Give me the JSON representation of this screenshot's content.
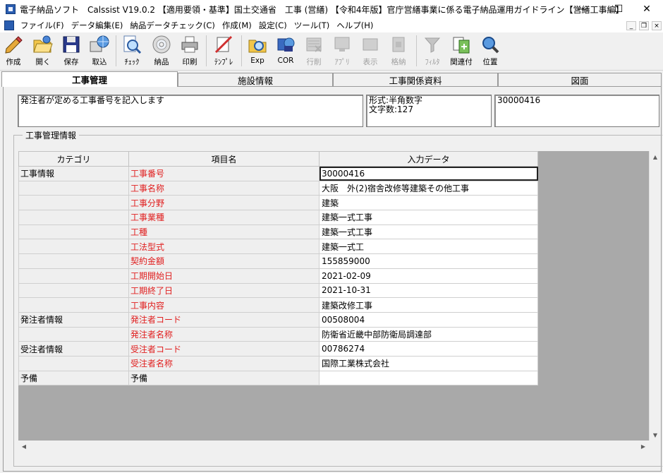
{
  "window": {
    "title": "電子納品ソフト　Calssist V19.0.2 【適用要領・基準】国土交通省　工事 (営繕) 【令和4年版】官庁営繕事業に係る電子納品運用ガイドライン【営繕工事編】",
    "minimize": "—",
    "maximize": "☐",
    "close": "✕"
  },
  "menu": {
    "items": [
      "ファイル(F)",
      "データ編集(E)",
      "納品データチェック(C)",
      "作成(M)",
      "設定(C)",
      "ツール(T)",
      "ヘルプ(H)"
    ],
    "mdi_min": "_",
    "mdi_restore": "❐",
    "mdi_close": "×"
  },
  "toolbar": {
    "create": "作成",
    "open": "開く",
    "save": "保存",
    "import": "取込",
    "check": "ﾁｪｯｸ",
    "deliver": "納品",
    "print": "印刷",
    "template": "ﾃﾝﾌﾟﾚ",
    "exp": "Exp",
    "cor": "COR",
    "row_delete": "行削",
    "app": "ｱﾌﾟﾘ",
    "display": "表示",
    "store": "格納",
    "filter": "ﾌｨﾙﾀ",
    "link": "関連付",
    "position": "位置"
  },
  "tabs": [
    "工事管理",
    "施設情報",
    "工事関係資料",
    "図面"
  ],
  "description": "発注者が定める工事番号を記入します",
  "format_info": "形式:半角数字\n文字数:127",
  "current_value": "30000416",
  "group_title": "工事管理情報",
  "grid": {
    "headers": [
      "カテゴリ",
      "項目名",
      "入力データ"
    ],
    "rows": [
      {
        "category": "工事情報",
        "name": "工事番号",
        "value": "30000416",
        "required": true
      },
      {
        "category": "",
        "name": "工事名称",
        "value": "大阪　外(2)宿舎改修等建築その他工事",
        "required": true
      },
      {
        "category": "",
        "name": "工事分野",
        "value": "建築",
        "required": true
      },
      {
        "category": "",
        "name": "工事業種",
        "value": "建築一式工事",
        "required": true
      },
      {
        "category": "",
        "name": "工種",
        "value": "建築一式工事",
        "required": true
      },
      {
        "category": "",
        "name": "工法型式",
        "value": "建築一式工",
        "required": true
      },
      {
        "category": "",
        "name": "契約金額",
        "value": "155859000",
        "required": true
      },
      {
        "category": "",
        "name": "工期開始日",
        "value": "2021-02-09",
        "required": true
      },
      {
        "category": "",
        "name": "工期終了日",
        "value": "2021-10-31",
        "required": true
      },
      {
        "category": "",
        "name": "工事内容",
        "value": "建築改修工事",
        "required": true
      },
      {
        "category": "発注者情報",
        "name": "発注者コード",
        "value": "00508004",
        "required": true
      },
      {
        "category": "",
        "name": "発注者名称",
        "value": "防衛省近畿中部防衛局調達部",
        "required": true
      },
      {
        "category": "受注者情報",
        "name": "受注者コード",
        "value": "00786274",
        "required": true
      },
      {
        "category": "",
        "name": "受注者名称",
        "value": "国際工業株式会社",
        "required": true
      },
      {
        "category": "予備",
        "name": "予備",
        "value": "",
        "required": false
      }
    ]
  },
  "colors": {
    "required": "#e02020",
    "grid_background": "#a9a9a9"
  }
}
